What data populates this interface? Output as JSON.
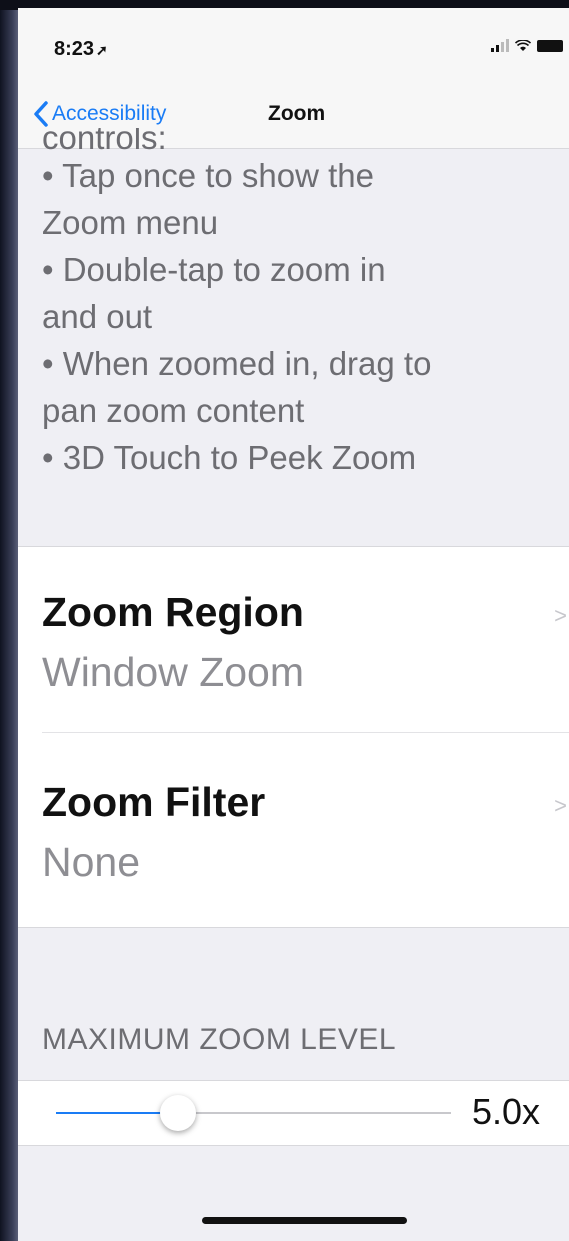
{
  "status": {
    "time": "8:23"
  },
  "nav": {
    "back_label": "Accessibility",
    "title": "Zoom"
  },
  "description": {
    "clipped_line": "controls:",
    "lines": [
      "• Tap once to show the",
      "Zoom menu",
      "• Double-tap to zoom in",
      "and out",
      "• When zoomed in, drag to",
      "pan zoom content",
      "• 3D Touch to Peek Zoom"
    ]
  },
  "settings": [
    {
      "title": "Zoom Region",
      "value": "Window Zoom"
    },
    {
      "title": "Zoom Filter",
      "value": "None"
    }
  ],
  "max_zoom": {
    "header": "MAXIMUM ZOOM LEVEL",
    "value_label": "5.0x",
    "slider_fraction": 0.31
  },
  "colors": {
    "accent": "#1a7cf5",
    "background": "#efeff4"
  }
}
